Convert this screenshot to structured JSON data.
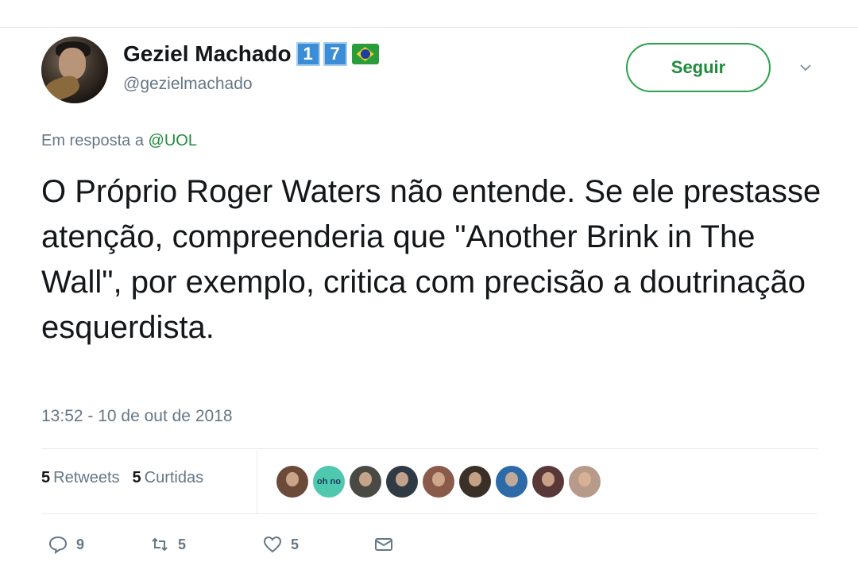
{
  "tweet": {
    "author_name": "Geziel Machado",
    "badges": [
      "1",
      "7"
    ],
    "handle": "@gezielmachado",
    "follow_label": "Seguir",
    "reply_prefix": "Em resposta a",
    "reply_to": "@UOL",
    "text": "O Próprio Roger Waters não entende. Se ele prestasse atenção, compreenderia que \"Another Brink in The Wall\", por exemplo, critica com precisão a doutrinação esquerdista.",
    "timestamp": "13:52 - 10 de out de 2018",
    "retweets_count": "5",
    "retweets_label": "Retweets",
    "likes_count": "5",
    "likes_label": "Curtidas",
    "liker_ohno_text": "oh no",
    "actions": {
      "reply_count": "9",
      "retweet_count": "5",
      "like_count": "5"
    }
  },
  "colors": {
    "accent": "#1e8c3c",
    "text": "#14171a",
    "muted": "#657786",
    "badge": "#3b8ed6"
  },
  "icons": [
    "flag-brazil-icon",
    "chevron-down-icon",
    "reply-icon",
    "retweet-icon",
    "heart-icon",
    "message-icon"
  ]
}
